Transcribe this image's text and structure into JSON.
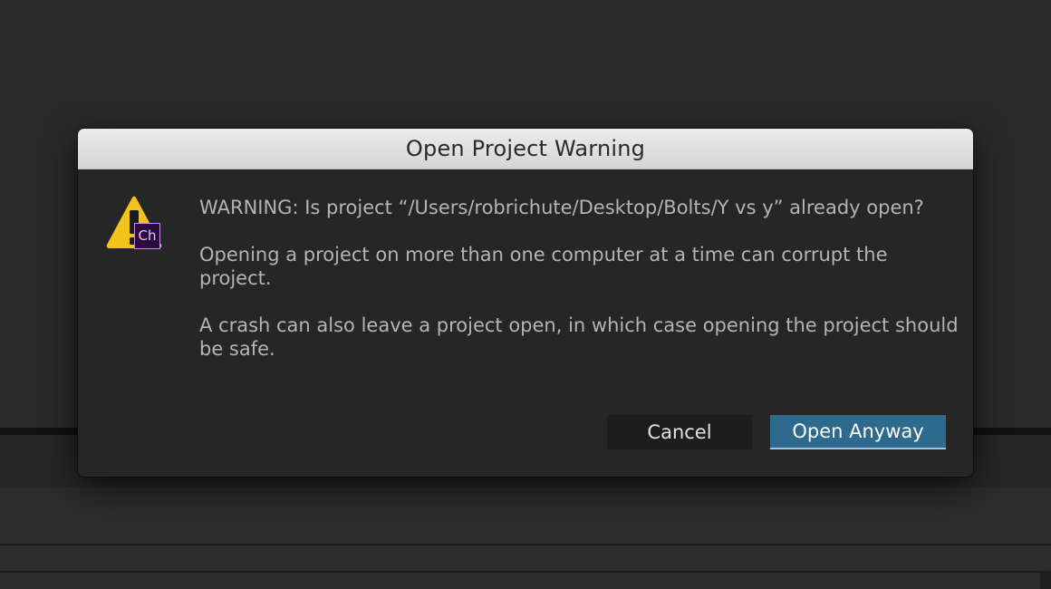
{
  "dialog": {
    "title": "Open Project Warning",
    "warning_line": "WARNING: Is project “/Users/robrichute/Desktop/Bolts/Y vs y” already open?",
    "paragraph_1": "Opening a project on more than one computer at a time can corrupt the project.",
    "paragraph_2": "A crash can also leave a project open, in which case opening the project should be safe.",
    "icon": "warning-icon",
    "app_badge": "Ch",
    "buttons": {
      "cancel": "Cancel",
      "open_anyway": "Open Anyway"
    }
  },
  "colors": {
    "accent": "#2d6a8e",
    "warning": "#f2c318",
    "badge_bg": "#2d0a3e",
    "badge_border": "#c28ee6"
  }
}
